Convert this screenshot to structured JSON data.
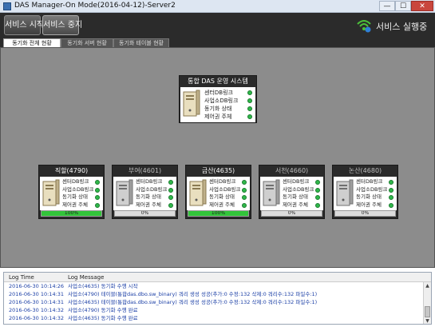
{
  "window": {
    "title": "DAS Manager-On Mode(2016-04-12)-Server2",
    "min_glyph": "—",
    "max_glyph": "☐",
    "close_glyph": "✕"
  },
  "toolbar": {
    "start_label": "서비스 시작",
    "stop_label": "서비스 중지",
    "status_text": "서비스 실행중",
    "status_icon": "wifi-icon"
  },
  "tabs": [
    {
      "label": "동기화 전체 현황"
    },
    {
      "label": "동기화 서버 현황"
    },
    {
      "label": "동기화 테이블 현황"
    }
  ],
  "main_node": {
    "title": "통합 DAS 운영 시스템",
    "rows": [
      "센터DB링크",
      "사업소DB링크",
      "동기화 상태",
      "제어권 주체"
    ]
  },
  "sites": [
    {
      "name": "직할(4790)",
      "rows": [
        "센터DB링크",
        "사업소DB링크",
        "동기화 상태",
        "제어권 주체"
      ],
      "progress": "100%",
      "progress_value": 100,
      "active": true
    },
    {
      "name": "부여(4601)",
      "rows": [
        "센터DB링크",
        "사업소DB링크",
        "동기화 상태",
        "제어권 주체"
      ],
      "progress": "0%",
      "progress_value": 0,
      "active": false
    },
    {
      "name": "금산(4635)",
      "rows": [
        "센터DB링크",
        "사업소DB링크",
        "동기화 상태",
        "제어권 주체"
      ],
      "progress": "100%",
      "progress_value": 100,
      "active": true
    },
    {
      "name": "서천(4660)",
      "rows": [
        "센터DB링크",
        "사업소DB링크",
        "동기화 상태",
        "제어권 주체"
      ],
      "progress": "0%",
      "progress_value": 0,
      "active": false
    },
    {
      "name": "논산(4680)",
      "rows": [
        "센터DB링크",
        "사업소DB링크",
        "동기화 상태",
        "제어권 주체"
      ],
      "progress": "0%",
      "progress_value": 0,
      "active": false
    }
  ],
  "log": {
    "col_time": "Log Time",
    "col_message": "Log Message",
    "entries": [
      {
        "time": "2016-06-30 10:14:26",
        "message": "사업소(4635) 동기화 수행 시작"
      },
      {
        "time": "2016-06-30 10:14:31",
        "message": "사업소(4790) 테이블(통합das.dbo.sw_binary) 쿼리 생성 성공(추가:0 수정:132 삭제:0 쿼리수:132 파일수:1)"
      },
      {
        "time": "2016-06-30 10:14:31",
        "message": "사업소(4635) 테이블(통합das.dbo.sw_binary) 쿼리 생성 성공(추가:0 수정:132 삭제:0 쿼리수:132 파일수:1)"
      },
      {
        "time": "2016-06-30 10:14:32",
        "message": "사업소(4790) 동기화 수행 완료"
      },
      {
        "time": "2016-06-30 10:14:32",
        "message": "사업소(4635) 동기화 수행 완료"
      }
    ]
  },
  "colors": {
    "ok_dot": "#2fb84a",
    "progress_fill": "#32c43a",
    "log_text": "#1b3fa6",
    "canvas_bg": "#8c8c8c",
    "header_bg": "#2b2b2b"
  }
}
